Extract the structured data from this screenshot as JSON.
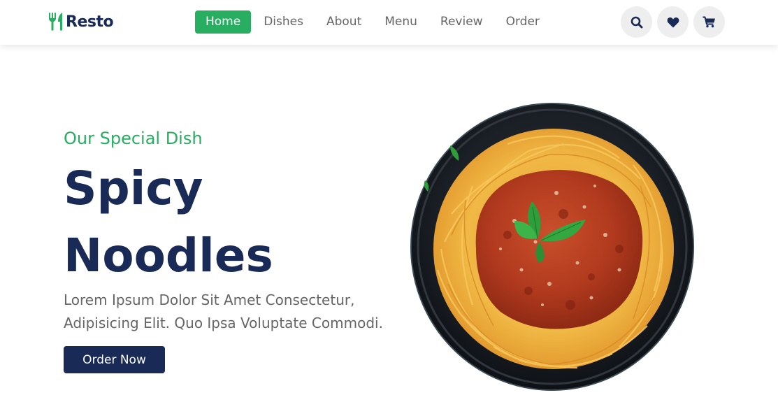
{
  "brand": {
    "name": "Resto",
    "icon": "utensils-icon",
    "accent": "#27ae60",
    "dark": "#192a56"
  },
  "nav": {
    "items": [
      {
        "label": "Home",
        "active": true
      },
      {
        "label": "Dishes",
        "active": false
      },
      {
        "label": "About",
        "active": false
      },
      {
        "label": "Menu",
        "active": false
      },
      {
        "label": "Review",
        "active": false
      },
      {
        "label": "Order",
        "active": false
      }
    ]
  },
  "header_icons": [
    "search-icon",
    "heart-icon",
    "cart-icon"
  ],
  "hero": {
    "subtitle": "Our Special Dish",
    "title_line1": "Spicy",
    "title_line2": "Noodles",
    "description": "Lorem Ipsum Dolor Sit Amet Consectetur, Adipisicing Elit. Quo Ipsa Voluptate Commodi.",
    "button_label": "Order Now",
    "image": "spaghetti-bolognese-plate"
  }
}
